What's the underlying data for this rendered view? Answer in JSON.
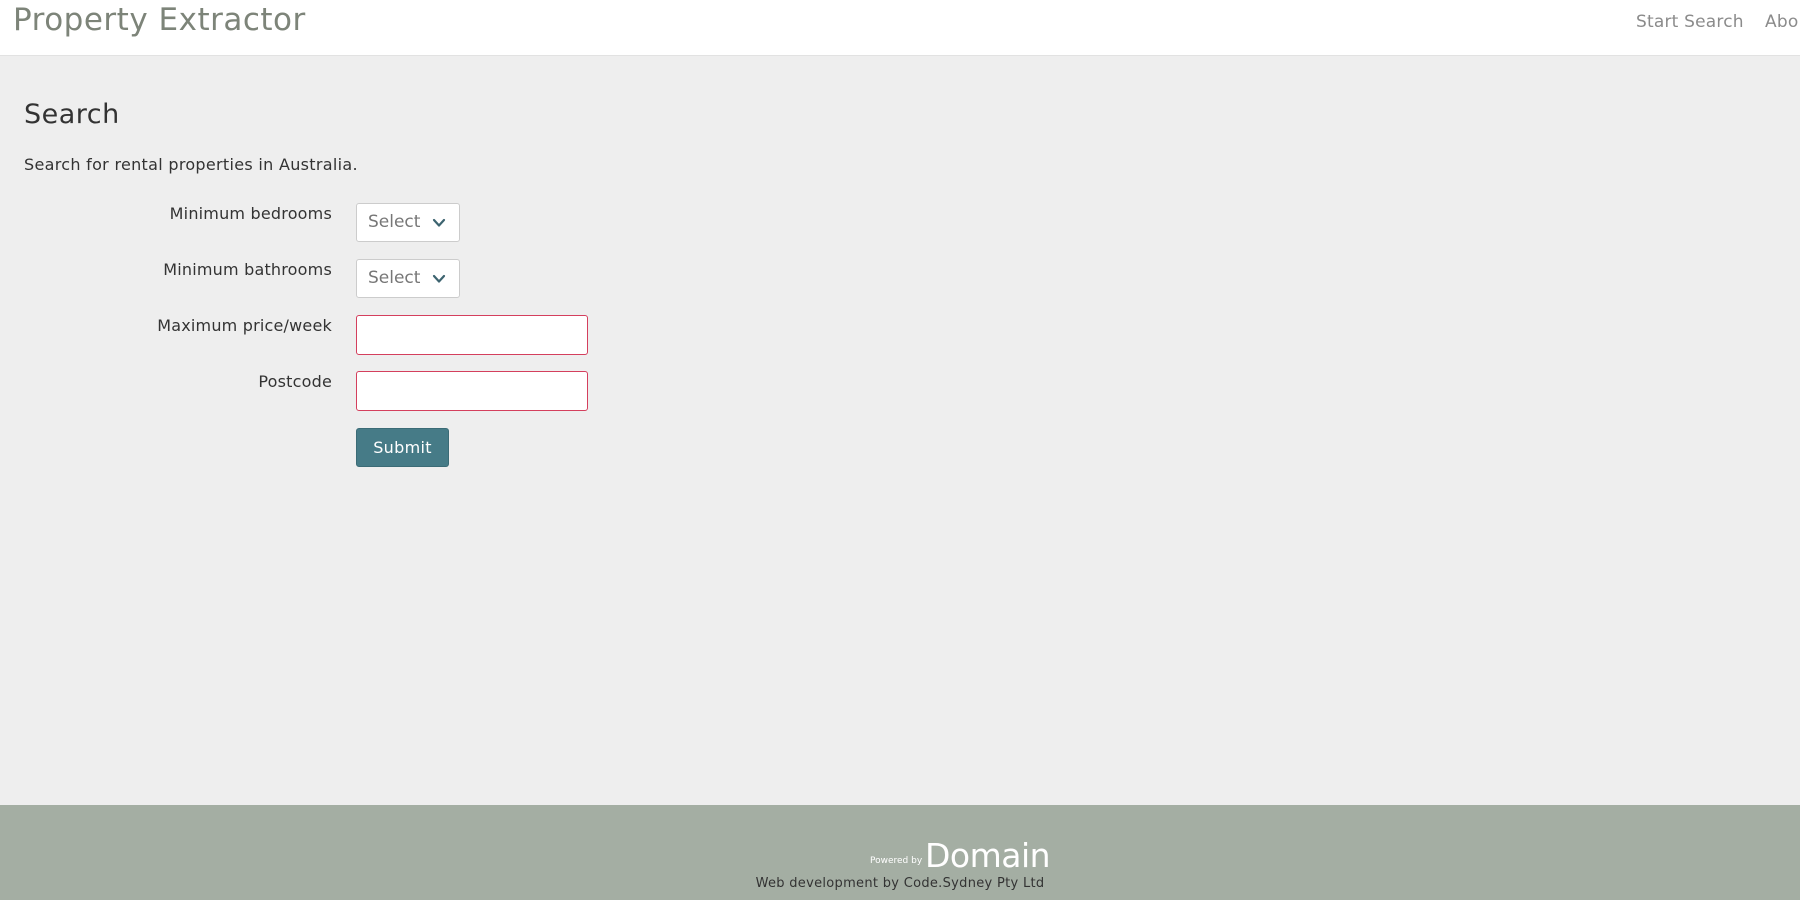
{
  "header": {
    "brand": "Property Extractor",
    "nav": {
      "start_search": "Start Search",
      "about": "Abo"
    }
  },
  "main": {
    "title": "Search",
    "lead": "Search for rental properties in Australia.",
    "form": {
      "min_bedrooms_label": "Minimum bedrooms",
      "min_bedrooms_value": "Select",
      "min_bathrooms_label": "Minimum bathrooms",
      "min_bathrooms_value": "Select",
      "max_price_label": "Maximum price/week",
      "max_price_value": "",
      "postcode_label": "Postcode",
      "postcode_value": "",
      "submit_label": "Submit"
    }
  },
  "footer": {
    "powered_by": "Powered by",
    "logo_text": "Domain",
    "credit": "Web development by Code.Sydney Pty Ltd"
  },
  "icons": {
    "select_arrow": "chevron-down-icon"
  },
  "colors": {
    "background": "#eeeeee",
    "header_bg": "#ffffff",
    "brand": "#7d8479",
    "button": "#467b87",
    "invalid_border": "#d43f5d",
    "footer_bg": "#a4aea3"
  }
}
